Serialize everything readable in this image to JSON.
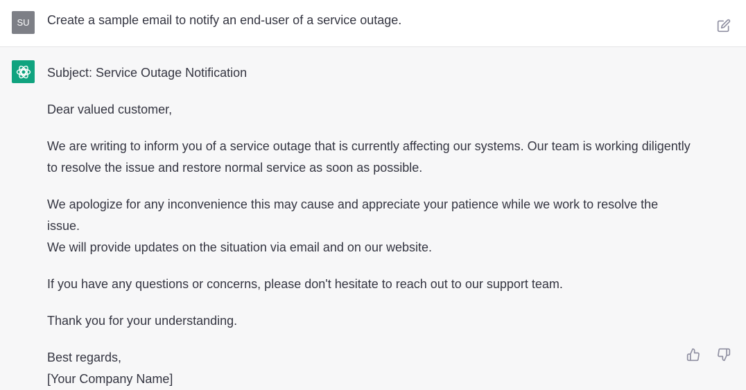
{
  "user_message": {
    "avatar_initials": "SU",
    "text": "Create a sample email to notify an end-user of a service outage."
  },
  "assistant_message": {
    "subject": "Subject: Service Outage Notification",
    "greeting": "Dear valued customer,",
    "paragraph1_line1": "We are writing to inform you of a service outage that is currently affecting our systems. Our team is working diligently",
    "paragraph1_line2": "to resolve the issue and restore normal service as soon as possible.",
    "paragraph2_line1": "We apologize for any inconvenience this may cause and appreciate your patience while we work to resolve the issue.",
    "paragraph2_line2": "We will provide updates on the situation via email and on our website.",
    "paragraph3": "If you have any questions or concerns, please don't hesitate to reach out to our support team.",
    "paragraph4": "Thank you for your understanding.",
    "closing": "Best regards,",
    "signature": "[Your Company Name]"
  },
  "icons": {
    "edit": "edit-icon",
    "thumbs_up": "thumbs-up-icon",
    "thumbs_down": "thumbs-down-icon",
    "assistant_logo": "openai-logo-icon"
  },
  "colors": {
    "assistant_avatar_bg": "#10a37f",
    "user_avatar_bg": "#7d7f86",
    "assistant_row_bg": "#f7f7f8"
  }
}
